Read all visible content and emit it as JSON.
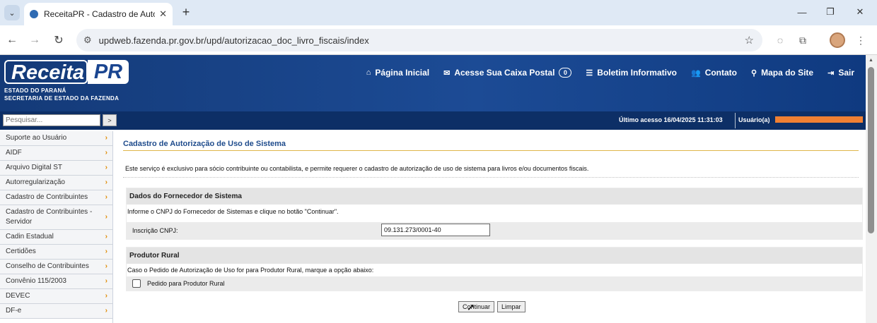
{
  "browser": {
    "tab_title": "ReceitaPR - Cadastro de Autoriza",
    "tab_close": "✕",
    "new_tab": "+",
    "url": "updweb.fazenda.pr.gov.br/upd/autorizacao_doc_livro_fiscais/index",
    "icons": [
      "tab-menu-icon",
      "favicon-icon",
      "back-icon",
      "forward-icon",
      "reload-icon",
      "site-settings-icon",
      "star-icon",
      "extensions-icon",
      "profile-avatar",
      "menu-icon",
      "minimize-icon",
      "restore-icon",
      "close-icon"
    ]
  },
  "header": {
    "logo_main": "Receita",
    "logo_pr": "PR",
    "logo_line1": "ESTADO DO PARANÁ",
    "logo_line2": "SECRETARIA DE ESTADO DA FAZENDA",
    "nav": [
      {
        "label": "Página Inicial",
        "icon": "home-icon"
      },
      {
        "label": "Acesse Sua Caixa Postal",
        "icon": "envelope-icon",
        "badge": "0"
      },
      {
        "label": "Boletim Informativo",
        "icon": "list-icon"
      },
      {
        "label": "Contato",
        "icon": "users-icon"
      },
      {
        "label": "Mapa do Site",
        "icon": "map-marker-icon"
      },
      {
        "label": "Sair",
        "icon": "sign-out-icon"
      }
    ]
  },
  "subbar": {
    "search_placeholder": "Pesquisar...",
    "search_button": ">",
    "last_access": "Último acesso 16/04/2025 11:31:03",
    "user_label": "Usuário(a)"
  },
  "sidebar": {
    "items": [
      "Suporte ao Usuário",
      "AIDF",
      "Arquivo Digital ST",
      "Autorregularização",
      "Cadastro de Contribuintes",
      "Cadastro de Contribuintes - Servidor",
      "Cadin Estadual",
      "Certidões",
      "Conselho de Contribuintes",
      "Convênio 115/2003",
      "DEVEC",
      "DF-e"
    ],
    "arrow": "›"
  },
  "main": {
    "title": "Cadastro de Autorização de Uso de Sistema",
    "description": "Este serviço é exclusivo para sócio contribuinte ou contabilista, e permite requerer o cadastro de autorização de uso de sistema para livros e/ou documentos fiscais.",
    "fornecedor": {
      "heading": "Dados do Fornecedor de Sistema",
      "instruction": "Informe o CNPJ do Fornecedor de Sistemas e clique no botão \"Continuar\".",
      "cnpj_label": "Inscrição CNPJ:",
      "cnpj_value": "09.131.273/0001-40"
    },
    "produtor": {
      "heading": "Produtor Rural",
      "instruction": "Caso o Pedido de Autorização de Uso for para Produtor Rural, marque a opção abaixo:",
      "checkbox_label": "Pedido para Produtor Rural",
      "checked": false
    },
    "buttons": {
      "continue": "Continuar",
      "clear": "Limpar"
    }
  },
  "colors": {
    "header_blue": "#1c4b95",
    "subbar_blue": "#0d2f66",
    "title_blue": "#1e4b8c",
    "accent_orange": "#e08a00",
    "redaction": "#f08033"
  }
}
